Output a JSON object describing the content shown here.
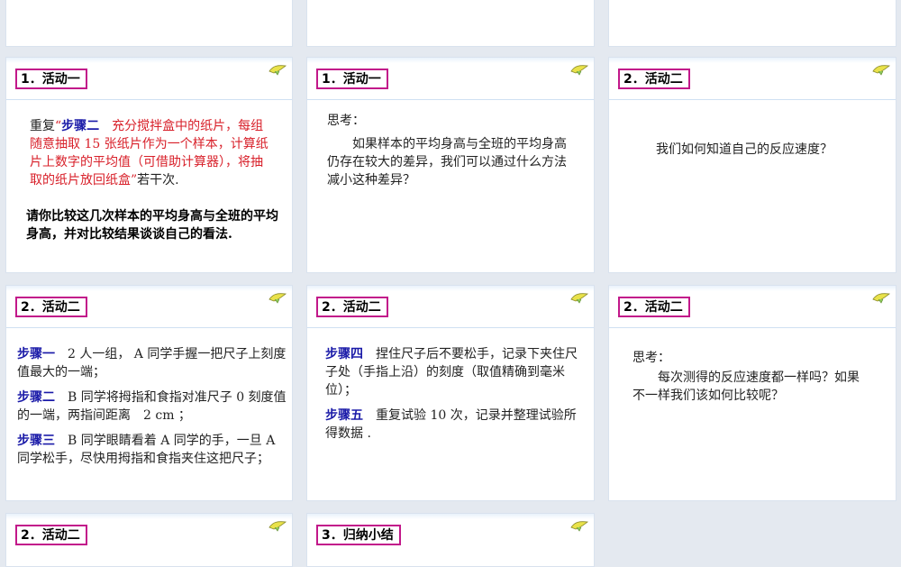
{
  "colors": {
    "accent_border": "#c2188a",
    "step_label": "#1a1aa8",
    "highlight": "#d8202a"
  },
  "icons": {
    "logo": "bird-logo-icon"
  },
  "slides": [
    {
      "title": ""
    },
    {
      "title": ""
    },
    {
      "title": ""
    },
    {
      "title": "1．活动一",
      "intro": "重复",
      "quote_open": "“",
      "step_label": "步骤二",
      "red_text": "　充分搅拌盒中的纸片，每组随意抽取 15 张纸片作为一个样本，计算纸片上数字的平均值（可借助计算器），将抽取的纸片放回纸盒”",
      "tail": "若干次.",
      "question": "请你比较这几次样本的平均身高与全班的平均身高，并对比较结果谈谈自己的看法."
    },
    {
      "title": "1．活动一",
      "think": "思考：",
      "text": "如果样本的平均身高与全班的平均身高仍存在较大的差异，我们可以通过什么方法减小这种差异？"
    },
    {
      "title": "2．活动二",
      "text": "我们如何知道自己的反应速度？"
    },
    {
      "title": "2．活动二",
      "steps": [
        {
          "label": "步骤一",
          "text": "　2 人一组， A 同学手握一把尺子上刻度值最大的一端；"
        },
        {
          "label": "步骤二",
          "text": "　B 同学将拇指和食指对准尺子 0 刻度值的一端，两指间距离　2 cm ；"
        },
        {
          "label": "步骤三",
          "text": "　B 同学眼睛看着 A 同学的手，一旦 A 同学松手，尽快用拇指和食指夹住这把尺子；"
        }
      ]
    },
    {
      "title": "2．活动二",
      "steps": [
        {
          "label": "步骤四",
          "text": "　捏住尺子后不要松手，记录下夹住尺子处（手指上沿）的刻度（取值精确到毫米位）；"
        },
        {
          "label": "步骤五",
          "text": "　重复试验 10 次，记录并整理试验所得数据 ."
        }
      ]
    },
    {
      "title": "2．活动二",
      "think": "思考：",
      "text": "每次测得的反应速度都一样吗？如果不一样我们该如何比较呢？"
    },
    {
      "title": "2．活动二"
    },
    {
      "title": "3．归纳小结"
    }
  ]
}
